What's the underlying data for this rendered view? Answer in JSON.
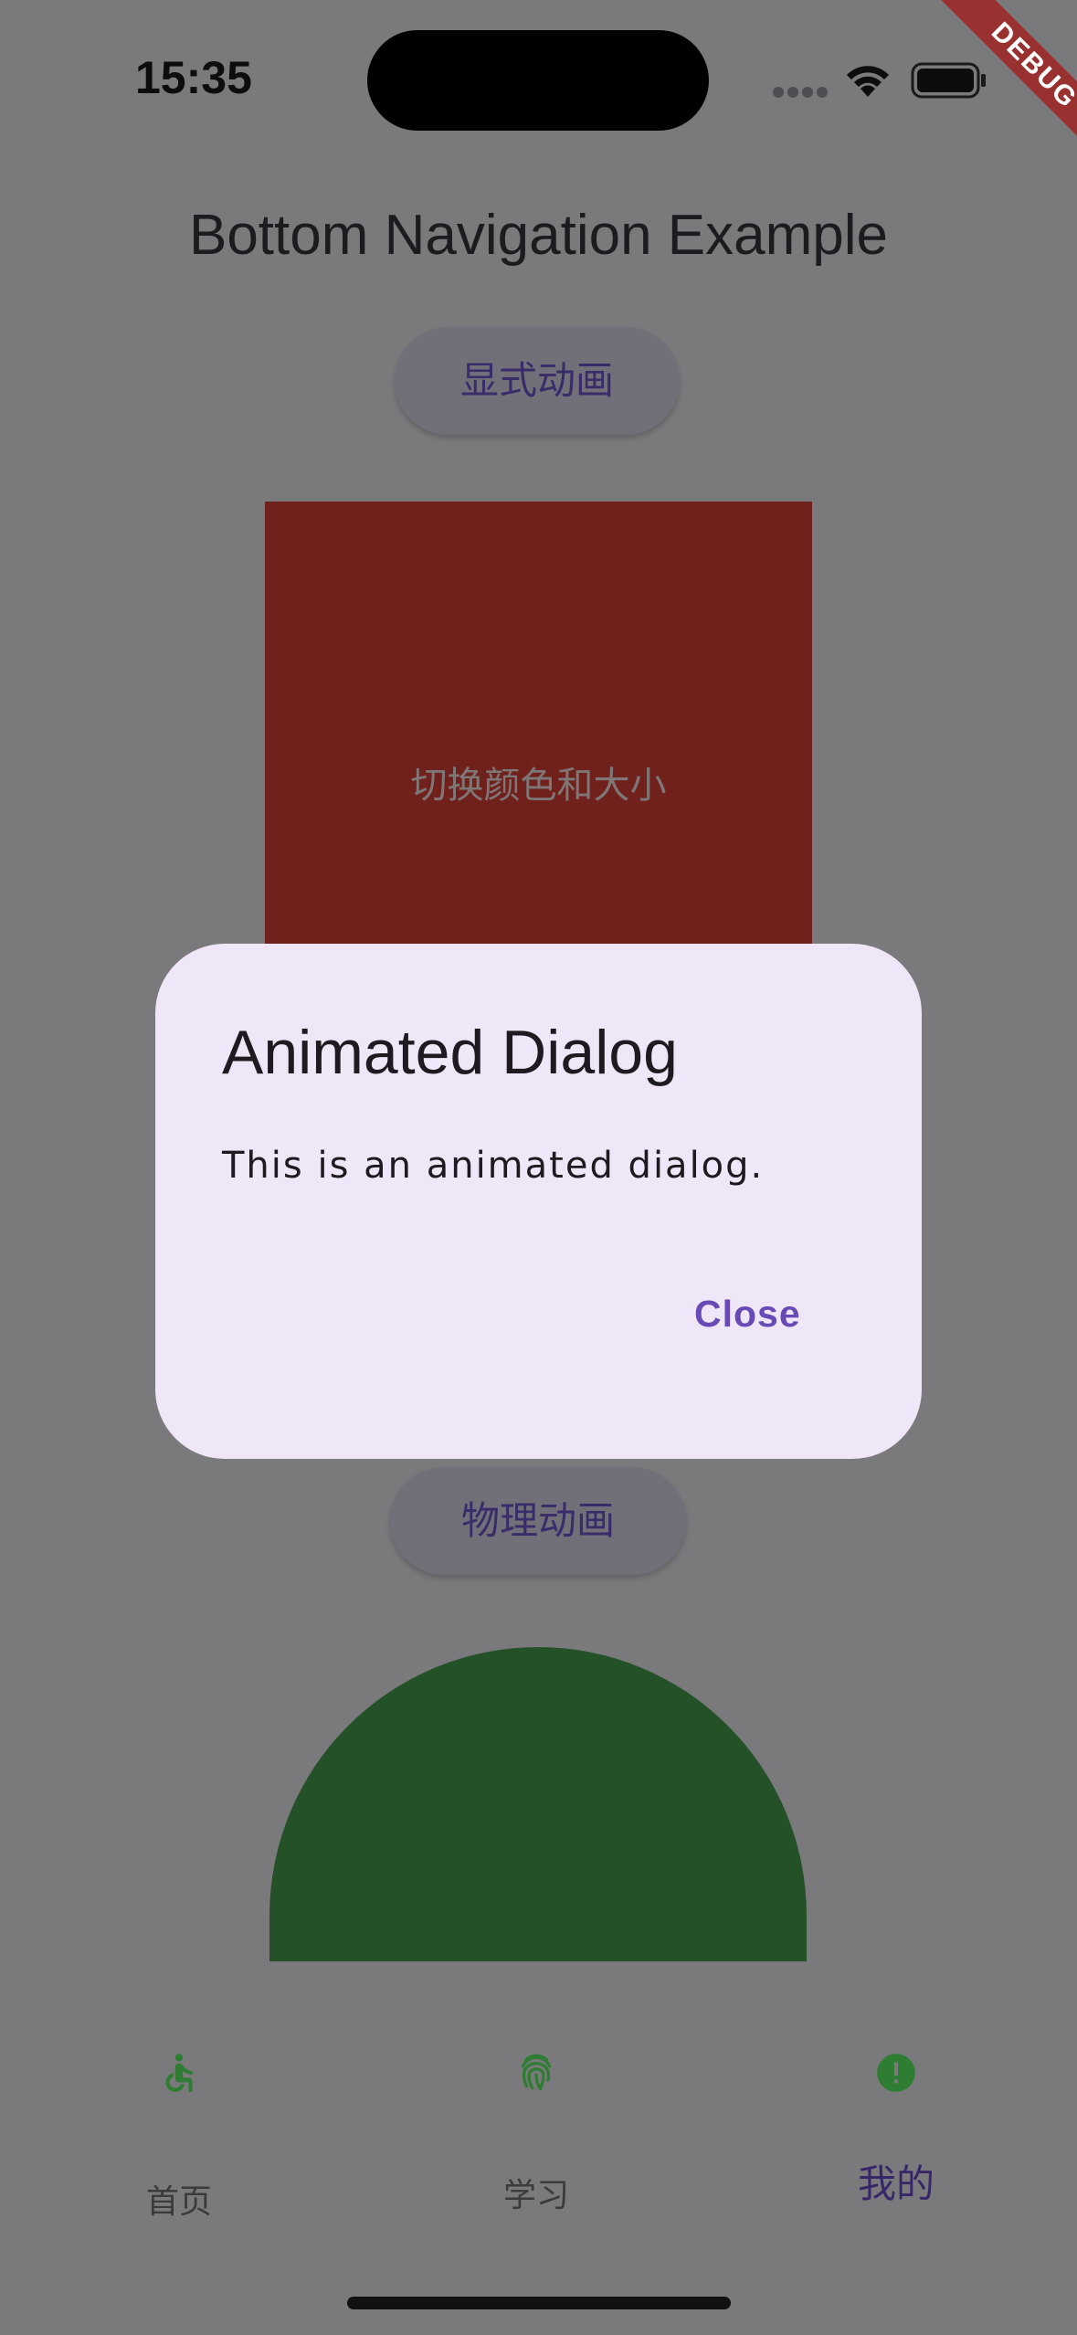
{
  "status_bar": {
    "time": "15:35",
    "icons": [
      "signal-dots-icon",
      "wifi-icon",
      "battery-icon"
    ]
  },
  "debug_banner": "DEBUG",
  "app_bar": {
    "title": "Bottom Navigation Example"
  },
  "buttons": {
    "explicit_animation": "显式动画",
    "physics_animation": "物理动画"
  },
  "animated_box": {
    "label": "切换颜色和大小",
    "color": "#71211c"
  },
  "semicircle": {
    "color": "#245128"
  },
  "dialog": {
    "title": "Animated Dialog",
    "content": "This is an animated dialog.",
    "close_label": "Close",
    "accent_color": "#6849b5"
  },
  "bottom_nav": {
    "items": [
      {
        "label": "首页",
        "icon": "accessible-icon",
        "selected": false
      },
      {
        "label": "学习",
        "icon": "fingerprint-icon",
        "selected": false
      },
      {
        "label": "我的",
        "icon": "error-icon",
        "selected": true
      }
    ],
    "icon_color": "#2f7d32"
  }
}
